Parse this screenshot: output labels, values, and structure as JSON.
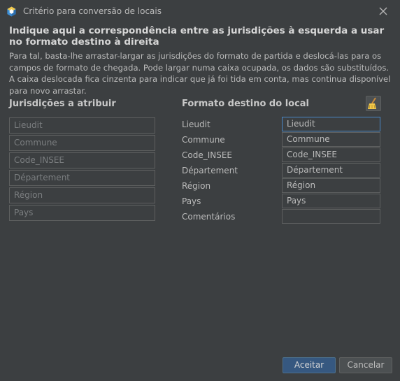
{
  "window": {
    "title": "Critério para conversão de locais",
    "app_icon": "app-hex-icon",
    "close_icon": "close-icon"
  },
  "heading": "Indique aqui a correspondência entre as jurisdições à esquerda a usar no formato destino à direita",
  "description": "Para tal, basta-lhe arrastar-largar as jurisdições do formato de partida e deslocá-las para os campos de formato de chegada. Pode largar numa caixa ocupada, os dados são substituídos. A caixa deslocada fica cinzenta para indicar que já foi tida em conta, mas continua disponível para novo arrastar.",
  "source": {
    "title": "Jurisdições a atribuir",
    "items": [
      "Lieudit",
      "Commune",
      "Code_INSEE",
      "Département",
      "Région",
      "Pays"
    ]
  },
  "target": {
    "title": "Formato destino do local",
    "clear_icon": "broom-icon",
    "rows": [
      {
        "label": "Lieudit",
        "value": "Lieudit"
      },
      {
        "label": "Commune",
        "value": "Commune"
      },
      {
        "label": "Code_INSEE",
        "value": "Code_INSEE"
      },
      {
        "label": "Département",
        "value": "Département"
      },
      {
        "label": "Région",
        "value": "Région"
      },
      {
        "label": "Pays",
        "value": "Pays"
      },
      {
        "label": "Comentários",
        "value": ""
      }
    ]
  },
  "buttons": {
    "accept": "Aceitar",
    "cancel": "Cancelar"
  },
  "colors": {
    "background": "#3c3f41",
    "accent": "#365880",
    "focus": "#4a88c7"
  }
}
